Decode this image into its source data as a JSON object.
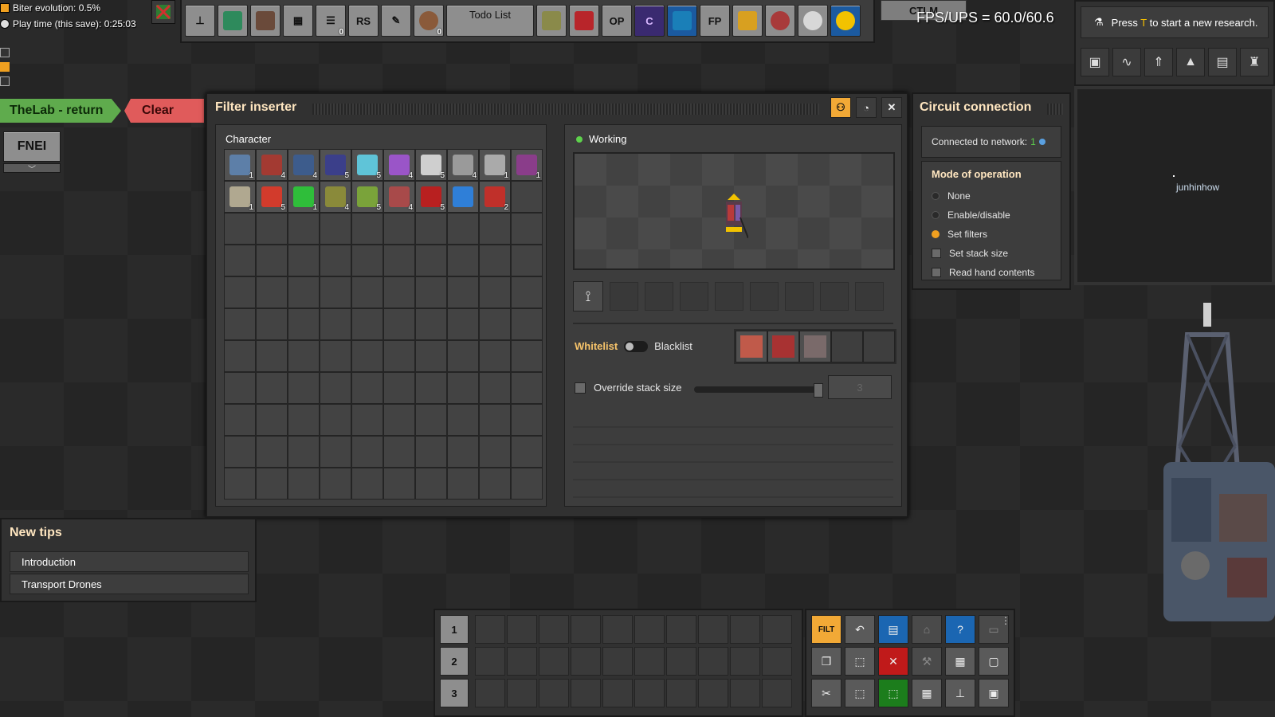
{
  "hud": {
    "biter_evolution": "Biter evolution: 0.5%",
    "play_time": "Play time (this save): 0:25:03",
    "fps": "FPS/UPS = 60.0/60.6"
  },
  "toolbar": {
    "rs_label": "RS",
    "todo_label": "Todo List",
    "op_label": "OP",
    "fp_label": "FP",
    "ctlm_label": "CTLM",
    "list_count": "0",
    "wire_count": "0"
  },
  "research": {
    "prefix": "Press ",
    "key": "T",
    "suffix": " to start a new research."
  },
  "minimap": {
    "player_name": "junhinhow"
  },
  "quickbar": {
    "thelab_label": "TheLab - return",
    "clear_label": "Clear",
    "fnei_label": "FNEI"
  },
  "filter_window": {
    "title": "Filter inserter",
    "inventory_label": "Character",
    "status": "Working",
    "whitelist_label": "Whitelist",
    "blacklist_label": "Blacklist",
    "override_label": "Override stack size",
    "stack_value": "3",
    "items": [
      {
        "count": "1",
        "color": "#5d7fa8"
      },
      {
        "count": "4",
        "color": "#a33a32"
      },
      {
        "count": "4",
        "color": "#3d5c8c"
      },
      {
        "count": "5",
        "color": "#3b3f8a"
      },
      {
        "count": "5",
        "color": "#5fc4d8"
      },
      {
        "count": "4",
        "color": "#9a55c8"
      },
      {
        "count": "5",
        "color": "#cfcfcf"
      },
      {
        "count": "4",
        "color": "#9a9a9a"
      },
      {
        "count": "1",
        "color": "#aaaaaa"
      },
      {
        "count": "1",
        "color": "#8a3d8a"
      },
      {
        "count": "1",
        "color": "#b0a890"
      },
      {
        "count": "5",
        "color": "#d23b2c"
      },
      {
        "count": "1",
        "color": "#2fbe3a"
      },
      {
        "count": "4",
        "color": "#8a8a3a"
      },
      {
        "count": "5",
        "color": "#7aa33a"
      },
      {
        "count": "4",
        "color": "#a84a4a"
      },
      {
        "count": "5",
        "color": "#b82020"
      },
      {
        "count": "",
        "color": "#2f7fd8"
      },
      {
        "count": "2",
        "color": "#c0302a"
      }
    ]
  },
  "circuit": {
    "title": "Circuit connection",
    "network_prefix": "Connected to network: ",
    "network_id": "1",
    "mode_heading": "Mode of operation",
    "mode_none": "None",
    "mode_enable": "Enable/disable",
    "mode_set_filters": "Set filters",
    "opt_stack_size": "Set stack size",
    "opt_hand": "Read hand contents",
    "selected_mode": "Set filters"
  },
  "tips": {
    "heading": "New tips",
    "items": [
      "Introduction",
      "Transport Drones"
    ]
  },
  "hotbar": {
    "rows": [
      "1",
      "2",
      "3"
    ]
  },
  "shortcuts": {
    "filter_label": "FILT"
  }
}
